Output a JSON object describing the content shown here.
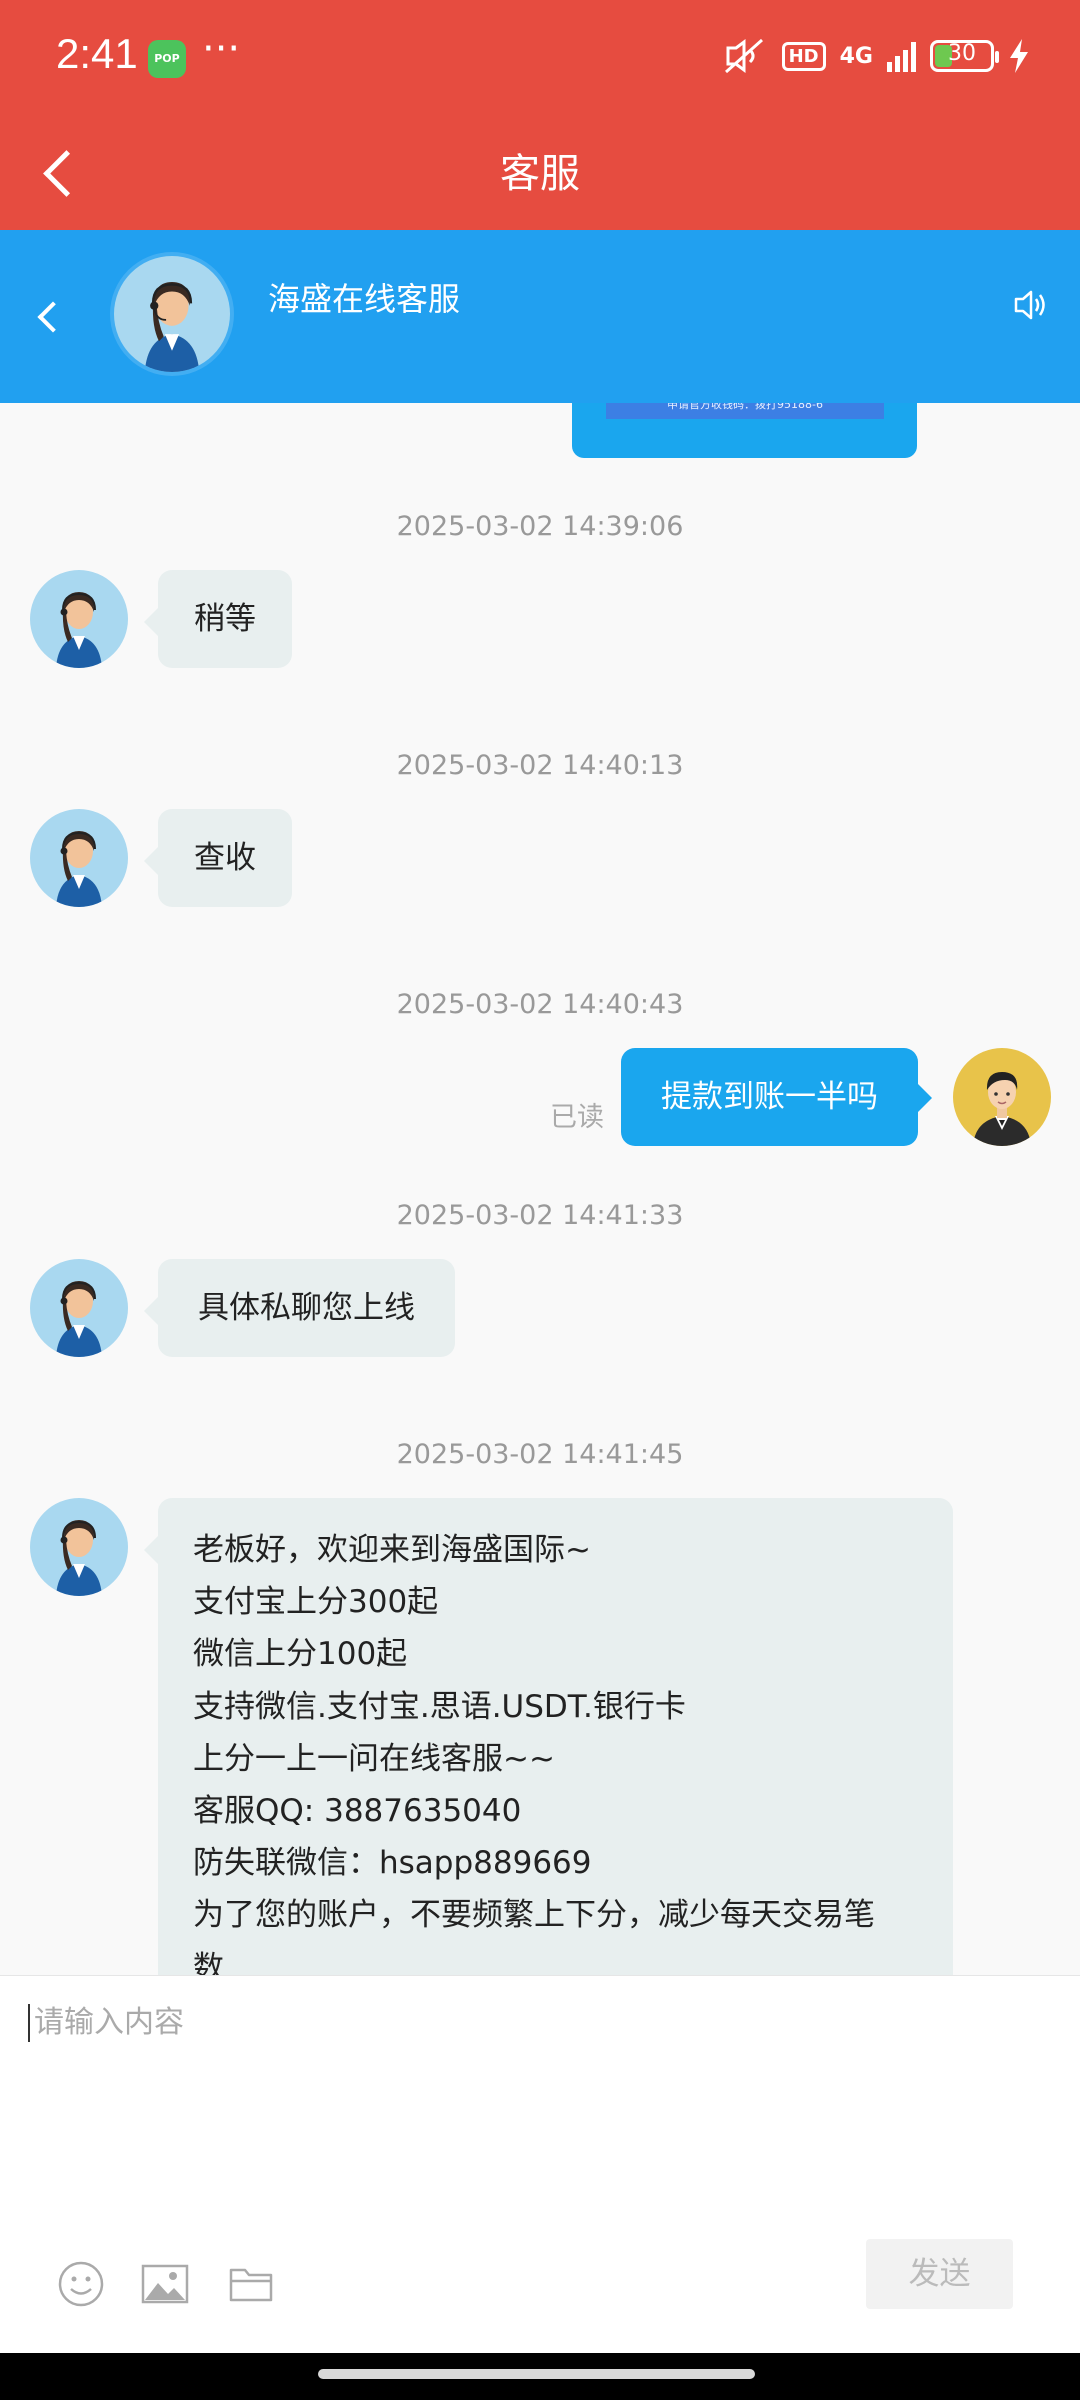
{
  "status_bar": {
    "time": "2:41",
    "app_icon_label": "POP",
    "more": "···",
    "network": "4G",
    "hd": "HD",
    "battery": "30",
    "icons": [
      "mute-icon",
      "hd-icon",
      "signal-icon",
      "battery-icon",
      "charging-icon"
    ]
  },
  "header": {
    "title": "客服"
  },
  "agent": {
    "name": "海盛在线客服"
  },
  "chat": {
    "partial_image_caption": "申请官方收钱码：拨打95188-6",
    "messages": [
      {
        "timestamp": "2025-03-02 14:39:06",
        "sender": "agent",
        "text": "稍等"
      },
      {
        "timestamp": "2025-03-02 14:40:13",
        "sender": "agent",
        "text": "查收"
      },
      {
        "timestamp": "2025-03-02 14:40:43",
        "sender": "user",
        "text": "提款到账一半吗",
        "status": "已读"
      },
      {
        "timestamp": "2025-03-02 14:41:33",
        "sender": "agent",
        "text": "具体私聊您上线"
      },
      {
        "timestamp": "2025-03-02 14:41:45",
        "sender": "agent",
        "lines": [
          "老板好，欢迎来到海盛国际~",
          "支付宝上分300起",
          "微信上分100起",
          "支持微信.支付宝.思语.USDT.银行卡",
          "上分一上一问在线客服~~",
          "客服QQ: 3887635040",
          "防失联微信：hsapp889669",
          "为了您的账户，不要频繁上下分，减少每天交易笔",
          "数"
        ]
      }
    ]
  },
  "input": {
    "placeholder": "请输入内容",
    "send_label": "发送"
  },
  "colors": {
    "header_red": "#e64c40",
    "agent_blue": "#21a0f0",
    "user_bubble": "#1aa6ee",
    "agent_bubble": "#e8efef"
  }
}
